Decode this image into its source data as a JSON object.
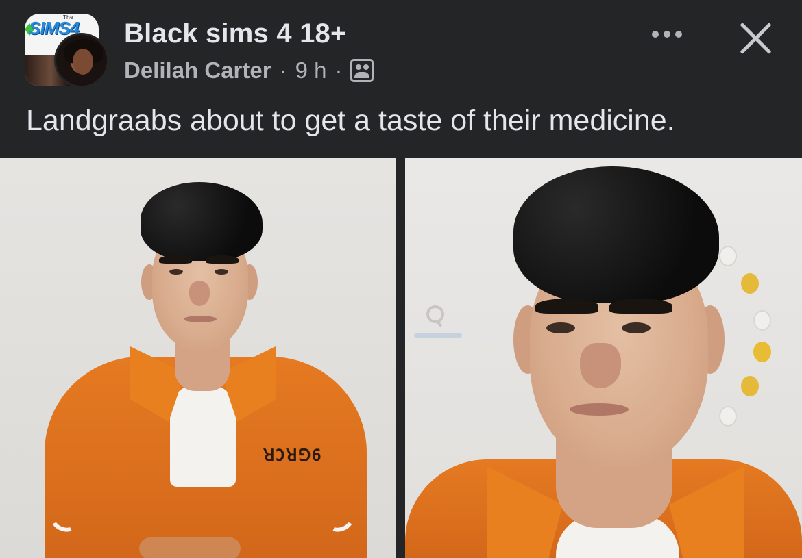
{
  "post": {
    "group_name": "Black sims 4 18+",
    "author": "Delilah Carter",
    "separator": "·",
    "time": "9 h",
    "caption": "Landgraabs about to get a taste of their medicine."
  },
  "group_avatar": {
    "logo_text": "SIMS4",
    "the_text": "The"
  },
  "photos": {
    "left": {
      "inmate_number": "ꓤƆꓤꓨ6"
    }
  },
  "colors": {
    "background": "#242526",
    "primary_text": "#e4e6eb",
    "secondary_text": "#b0b3b8",
    "jumpsuit": "#e57a22"
  },
  "icons": [
    "more-icon",
    "close-icon",
    "audience-icon",
    "search-icon",
    "rotate-left-icon",
    "rotate-right-icon"
  ]
}
